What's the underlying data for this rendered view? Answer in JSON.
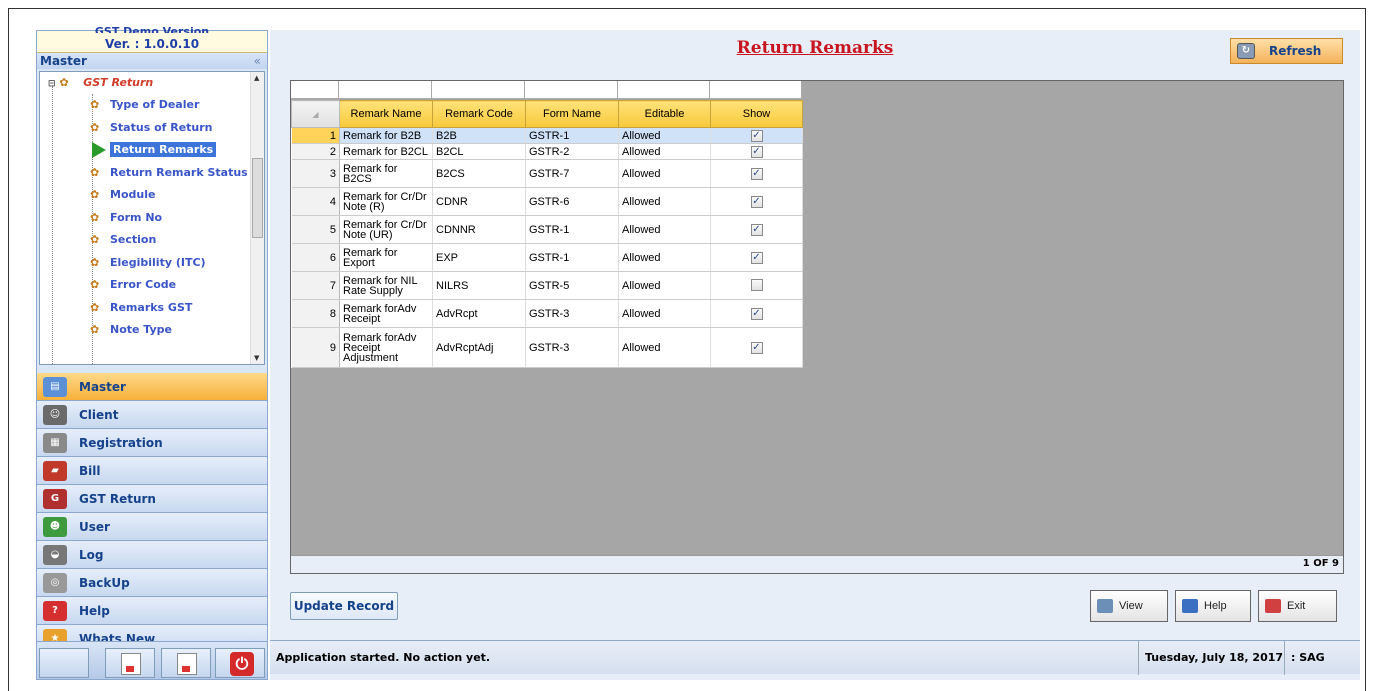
{
  "left_panel": {
    "version_hidden": "GST Demo Version",
    "version": "Ver. : 1.0.0.10",
    "master_header": "Master",
    "collapse_glyph": "«",
    "tree": {
      "root": "GST Return",
      "items": [
        {
          "label": "Type of Dealer",
          "icon": "gear-icon"
        },
        {
          "label": "Status of Return",
          "icon": "gear-icon"
        },
        {
          "label": "Return Remarks",
          "icon": "arrow-icon",
          "selected": true
        },
        {
          "label": "Return Remark Status",
          "icon": "gear-icon"
        },
        {
          "label": "Module",
          "icon": "gear-icon"
        },
        {
          "label": "Form No",
          "icon": "gear-icon"
        },
        {
          "label": "Section",
          "icon": "gear-icon"
        },
        {
          "label": "Elegibility (ITC)",
          "icon": "gear-icon"
        },
        {
          "label": "Error Code",
          "icon": "gear-icon"
        },
        {
          "label": "Remarks GST",
          "icon": "gear-icon"
        },
        {
          "label": "Note Type",
          "icon": "gear-icon"
        }
      ]
    },
    "nav": [
      {
        "label": "Master",
        "icon": "master-icon",
        "active": true
      },
      {
        "label": "Client",
        "icon": "client-icon"
      },
      {
        "label": "Registration",
        "icon": "registration-icon"
      },
      {
        "label": "Bill",
        "icon": "bill-icon"
      },
      {
        "label": "GST Return",
        "icon": "gst-icon"
      },
      {
        "label": "User",
        "icon": "user-icon"
      },
      {
        "label": "Log",
        "icon": "log-icon"
      },
      {
        "label": "BackUp",
        "icon": "backup-icon"
      },
      {
        "label": "Help",
        "icon": "help-icon"
      },
      {
        "label": "Whats New",
        "icon": "new-icon"
      }
    ]
  },
  "main": {
    "title": "Return Remarks",
    "refresh_label": "Refresh",
    "columns": [
      "Remark Name",
      "Remark Code",
      "Form Name",
      "Editable",
      "Show"
    ],
    "rows": [
      {
        "n": "1",
        "name": "Remark for B2B",
        "code": "B2B",
        "form": "GSTR-1",
        "editable": "Allowed",
        "show": true
      },
      {
        "n": "2",
        "name": "Remark for B2CL",
        "code": "B2CL",
        "form": "GSTR-2",
        "editable": "Allowed",
        "show": true
      },
      {
        "n": "3",
        "name": "Remark for B2CS",
        "code": "B2CS",
        "form": "GSTR-7",
        "editable": "Allowed",
        "show": true
      },
      {
        "n": "4",
        "name": "Remark for Cr/Dr Note (R)",
        "code": "CDNR",
        "form": "GSTR-6",
        "editable": "Allowed",
        "show": true
      },
      {
        "n": "5",
        "name": "Remark for Cr/Dr Note (UR)",
        "code": "CDNNR",
        "form": "GSTR-1",
        "editable": "Allowed",
        "show": true
      },
      {
        "n": "6",
        "name": "Remark for Export",
        "code": "EXP",
        "form": "GSTR-1",
        "editable": "Allowed",
        "show": true
      },
      {
        "n": "7",
        "name": "Remark for NIL Rate Supply",
        "code": "NILRS",
        "form": "GSTR-5",
        "editable": "Allowed",
        "show": false
      },
      {
        "n": "8",
        "name": "Remark forAdv Receipt",
        "code": "AdvRcpt",
        "form": "GSTR-3",
        "editable": "Allowed",
        "show": true
      },
      {
        "n": "9",
        "name": "Remark forAdv Receipt Adjustment",
        "code": "AdvRcptAdj",
        "form": "GSTR-3",
        "editable": "Allowed",
        "show": true
      }
    ],
    "page_indicator": "1 OF 9",
    "update_label": "Update Record",
    "view_label": "View",
    "help_label": "Help",
    "exit_label": "Exit"
  },
  "status": {
    "message": "Application started. No action yet.",
    "date": "Tuesday, July 18, 2017",
    "user": ": SAG"
  },
  "colors": {
    "title_red": "#c7141e",
    "nav_blue": "#15428b",
    "header_yellow": "#f7c93a",
    "grid_bg": "#a6a6a6"
  }
}
